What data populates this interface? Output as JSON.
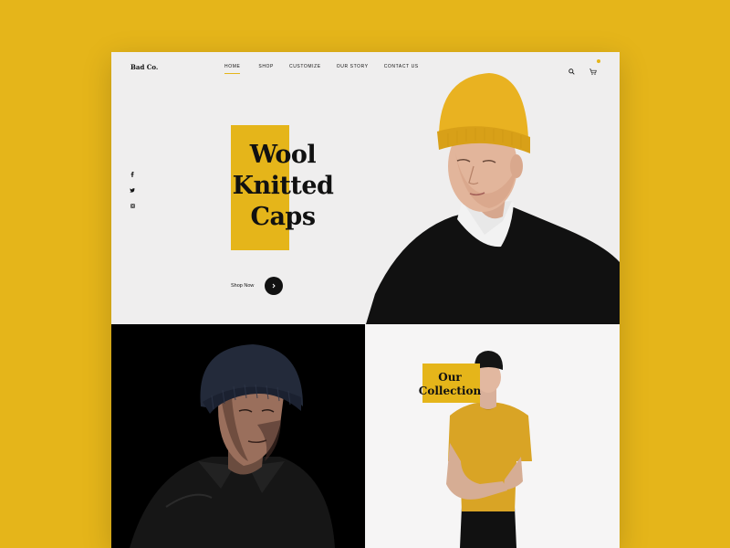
{
  "brand": "Bad Co.",
  "nav": {
    "items": [
      "HOME",
      "SHOP",
      "CUSTOMIZE",
      "OUR STORY",
      "CONTACT US"
    ],
    "active": "HOME"
  },
  "header_icons": [
    "search-icon",
    "cart-icon"
  ],
  "social_icons": [
    "facebook-icon",
    "twitter-icon",
    "instagram-icon"
  ],
  "hero": {
    "title_line1": "Wool",
    "title_line2": "Knitted",
    "title_line3": "Caps",
    "cta_label": "Shop Now"
  },
  "collection": {
    "title_line1": "Our",
    "title_line2": "Collection"
  },
  "colors": {
    "accent": "#e5b51a",
    "background": "#e5b51a",
    "page": "#efeeee",
    "dark": "#111111"
  }
}
